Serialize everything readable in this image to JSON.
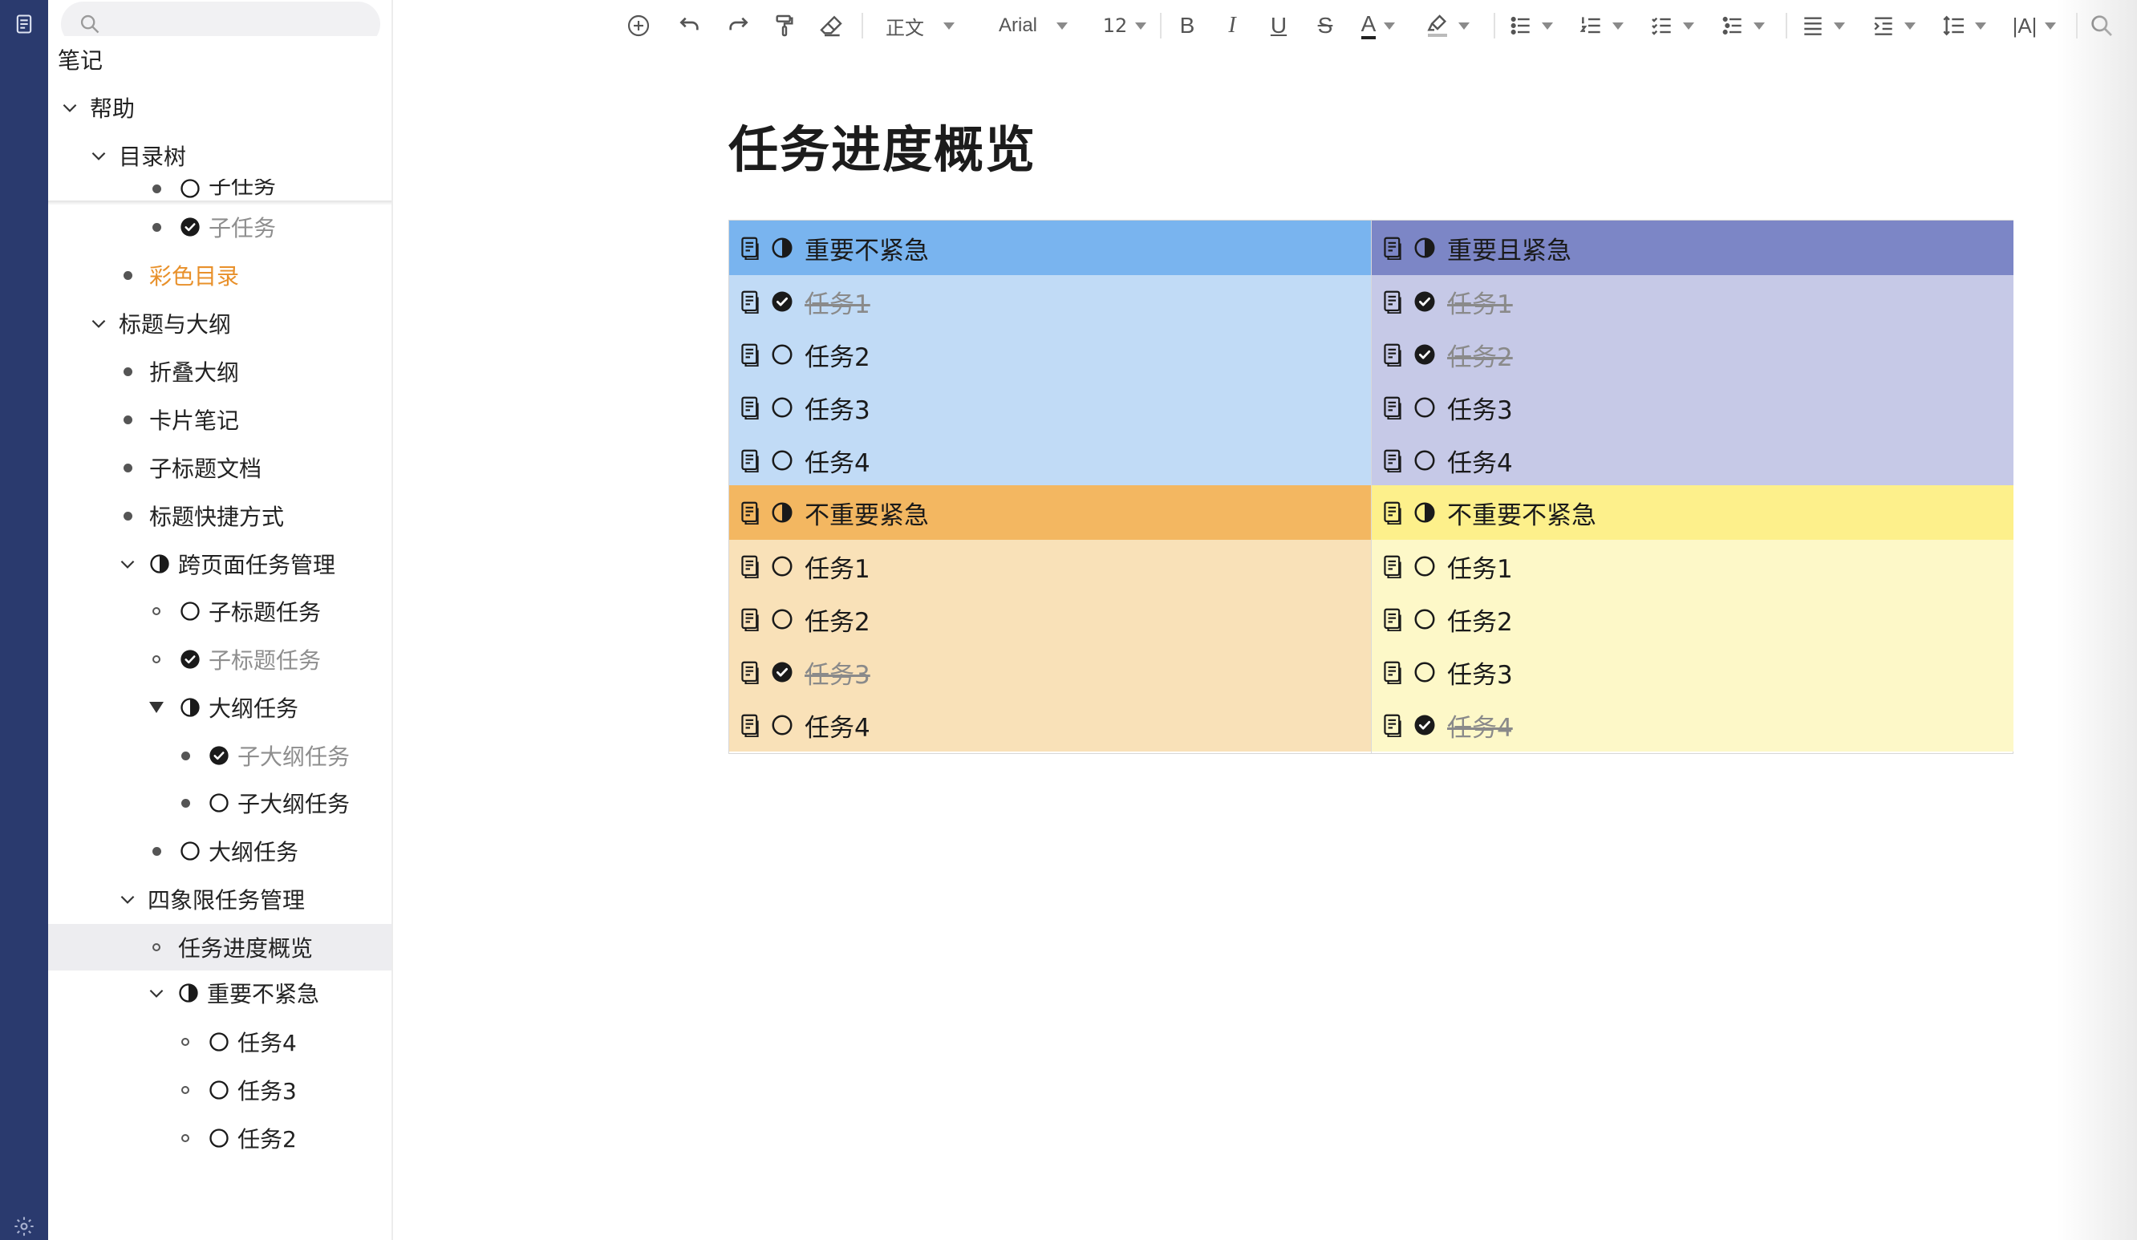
{
  "sidebar": {
    "search": {
      "placeholder": ""
    },
    "items": [
      {
        "label": "笔记",
        "depth": 0,
        "marker": "none",
        "status": "none",
        "style": "normal"
      },
      {
        "label": "帮助",
        "depth": 0,
        "marker": "chevron",
        "status": "none",
        "style": "normal"
      },
      {
        "label": "目录树",
        "depth": 1,
        "marker": "chevron",
        "status": "none",
        "style": "normal"
      },
      {
        "label": "子任务",
        "depth": 3,
        "marker": "dot",
        "status": "empty",
        "style": "normal"
      },
      {
        "label": "子任务",
        "depth": 3,
        "marker": "dot",
        "status": "done",
        "style": "muted"
      },
      {
        "label": "彩色目录",
        "depth": 2,
        "marker": "dot",
        "status": "none",
        "style": "orange"
      },
      {
        "label": "标题与大纲",
        "depth": 1,
        "marker": "chevron",
        "status": "none",
        "style": "normal"
      },
      {
        "label": "折叠大纲",
        "depth": 2,
        "marker": "dot",
        "status": "none",
        "style": "normal"
      },
      {
        "label": "卡片笔记",
        "depth": 2,
        "marker": "dot",
        "status": "none",
        "style": "normal"
      },
      {
        "label": "子标题文档",
        "depth": 2,
        "marker": "dot",
        "status": "none",
        "style": "normal"
      },
      {
        "label": "标题快捷方式",
        "depth": 2,
        "marker": "dot",
        "status": "none",
        "style": "normal"
      },
      {
        "label": "跨页面任务管理",
        "depth": 2,
        "marker": "chevron",
        "status": "partial",
        "style": "normal"
      },
      {
        "label": "子标题任务",
        "depth": 3,
        "marker": "ring",
        "status": "empty",
        "style": "normal"
      },
      {
        "label": "子标题任务",
        "depth": 3,
        "marker": "ring",
        "status": "done",
        "style": "muted"
      },
      {
        "label": "大纲任务",
        "depth": 3,
        "marker": "triangle",
        "status": "half",
        "style": "normal"
      },
      {
        "label": "子大纲任务",
        "depth": 4,
        "marker": "dot",
        "status": "done",
        "style": "muted"
      },
      {
        "label": "子大纲任务",
        "depth": 4,
        "marker": "dot",
        "status": "empty",
        "style": "normal"
      },
      {
        "label": "大纲任务",
        "depth": 3,
        "marker": "dot",
        "status": "empty",
        "style": "normal"
      },
      {
        "label": "四象限任务管理",
        "depth": 2,
        "marker": "chevron",
        "status": "none",
        "style": "normal"
      },
      {
        "label": "任务进度概览",
        "depth": 3,
        "marker": "ring",
        "status": "none",
        "style": "normal",
        "active": true
      },
      {
        "label": "重要不紧急",
        "depth": 3,
        "marker": "chevron",
        "status": "partial",
        "style": "normal"
      },
      {
        "label": "任务4",
        "depth": 4,
        "marker": "ring",
        "status": "empty",
        "style": "normal"
      },
      {
        "label": "任务3",
        "depth": 4,
        "marker": "ring",
        "status": "empty",
        "style": "normal"
      },
      {
        "label": "任务2",
        "depth": 4,
        "marker": "ring",
        "status": "empty",
        "style": "normal"
      }
    ]
  },
  "toolbar": {
    "paragraph_style": "正文",
    "font_family": "Arial",
    "font_size": "12",
    "icons": [
      "add-icon",
      "undo-icon",
      "redo-icon",
      "format-painter-icon",
      "eraser-icon",
      "bold-icon",
      "italic-icon",
      "underline-icon",
      "strikethrough-icon",
      "font-color-icon",
      "highlight-icon",
      "bullet-list-icon",
      "numbered-list-icon",
      "checklist-icon",
      "outline-list-icon",
      "align-icon",
      "indent-icon",
      "line-height-icon",
      "text-spacing-icon",
      "search-icon"
    ],
    "bold_label": "B",
    "italic_label": "I",
    "underline_label": "U",
    "strike_label": "S",
    "font_color_label": "A",
    "text_spacing_label": "|A|"
  },
  "document": {
    "title": "任务进度概览",
    "quadrants": [
      {
        "title": "重要不紧急",
        "status": "partial",
        "header_color": "#79b4ef",
        "body_color": "#c1dbf6",
        "tasks": [
          {
            "label": "任务1",
            "done": true
          },
          {
            "label": "任务2",
            "done": false
          },
          {
            "label": "任务3",
            "done": false
          },
          {
            "label": "任务4",
            "done": false
          }
        ]
      },
      {
        "title": "重要且紧急",
        "status": "half",
        "header_color": "#7c86c6",
        "body_color": "#c6c9e7",
        "tasks": [
          {
            "label": "任务1",
            "done": true
          },
          {
            "label": "任务2",
            "done": true
          },
          {
            "label": "任务3",
            "done": false
          },
          {
            "label": "任务4",
            "done": false
          }
        ]
      },
      {
        "title": "不重要紧急",
        "status": "partial",
        "header_color": "#f3b761",
        "body_color": "#f9e1b8",
        "tasks": [
          {
            "label": "任务1",
            "done": false
          },
          {
            "label": "任务2",
            "done": false
          },
          {
            "label": "任务3",
            "done": true
          },
          {
            "label": "任务4",
            "done": false
          }
        ]
      },
      {
        "title": "不重要不紧急",
        "status": "partial",
        "header_color": "#fdf08b",
        "body_color": "#fdf8c8",
        "tasks": [
          {
            "label": "任务1",
            "done": false
          },
          {
            "label": "任务2",
            "done": false
          },
          {
            "label": "任务3",
            "done": false
          },
          {
            "label": "任务4",
            "done": true
          }
        ]
      }
    ]
  },
  "colors": {
    "rail": "#2a3a6e",
    "accent_orange": "#e8902a"
  }
}
